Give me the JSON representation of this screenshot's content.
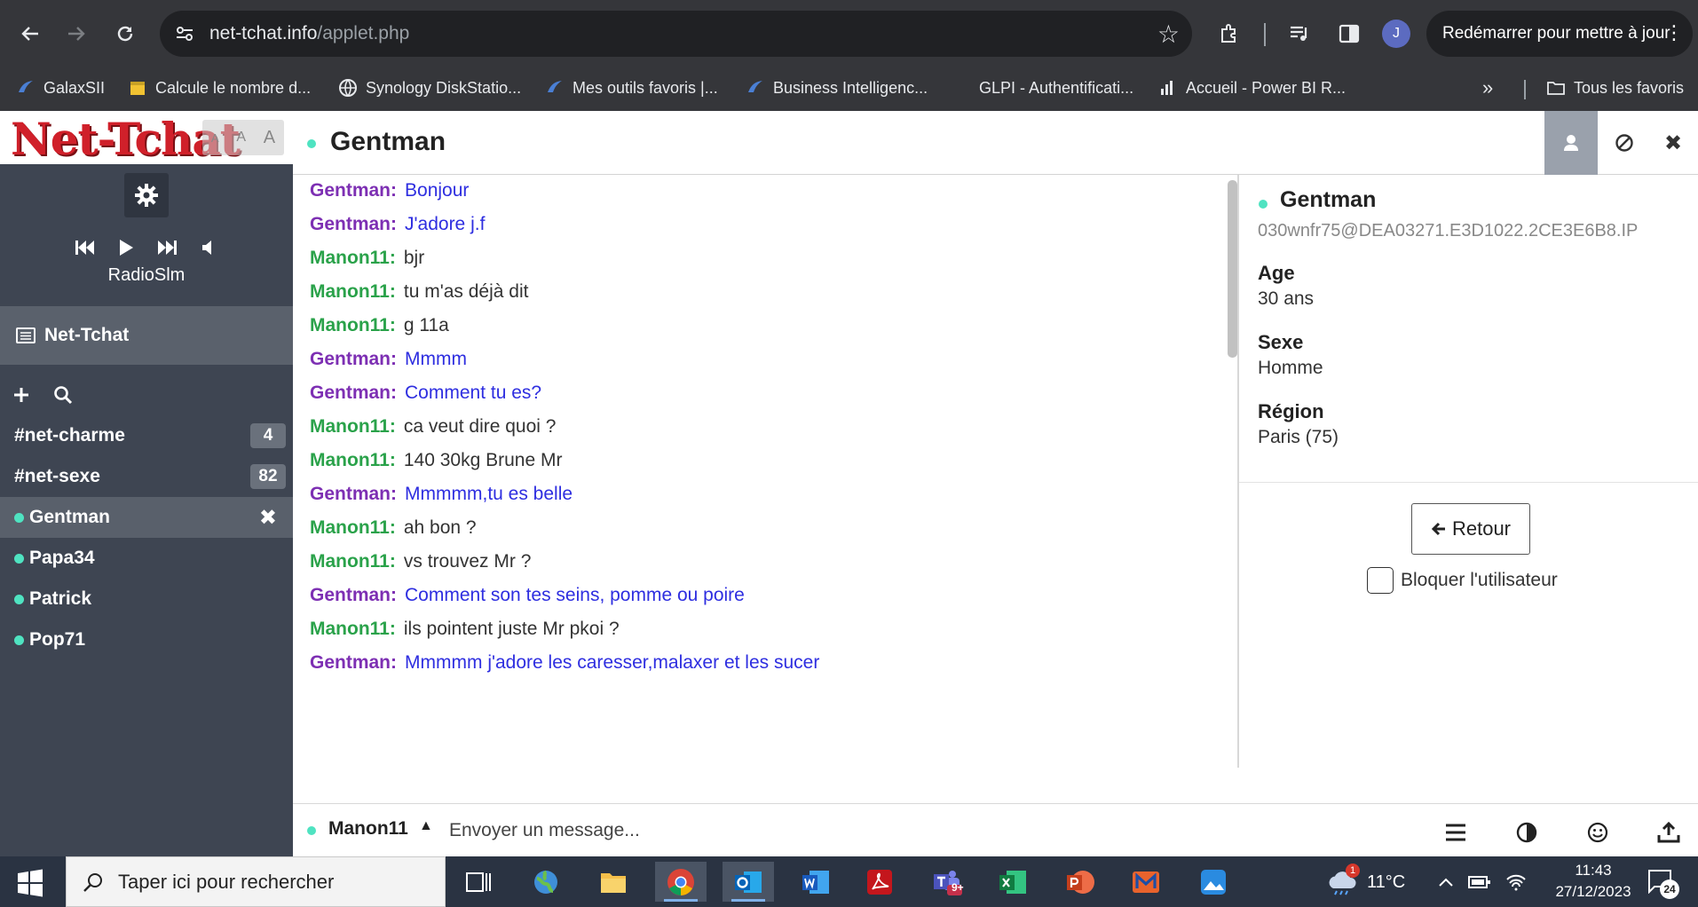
{
  "browser": {
    "url_host": "net-tchat.info",
    "url_path": "/applet.php",
    "profile_initial": "J",
    "update_label": "Redémarrer pour mettre à jour",
    "bookmarks": [
      {
        "label": "GalaxSII",
        "icon": "sii-icon"
      },
      {
        "label": "Calcule le nombre d...",
        "icon": "calendar-icon"
      },
      {
        "label": "Synology DiskStatio...",
        "icon": "globe-icon"
      },
      {
        "label": "Mes outils favoris |...",
        "icon": "sii-icon"
      },
      {
        "label": "Business Intelligenc...",
        "icon": "sii-icon"
      },
      {
        "label": "GLPI - Authentificati...",
        "icon": "glpi-icon"
      },
      {
        "label": "Accueil - Power BI R...",
        "icon": "powerbi-icon"
      }
    ],
    "all_bookmarks_label": "Tous les favoris"
  },
  "sidebar": {
    "logo_text": "Net-Tchat",
    "zoom_buttons": [
      "A",
      "A",
      "A"
    ],
    "radio_name": "RadioSlm",
    "channel_header": "Net-Tchat",
    "rooms": [
      {
        "label": "#net-charme",
        "count": "4"
      },
      {
        "label": "#net-sexe",
        "count": "82"
      }
    ],
    "users": [
      {
        "label": "Gentman",
        "active": true
      },
      {
        "label": "Papa34",
        "active": false
      },
      {
        "label": "Patrick",
        "active": false
      },
      {
        "label": "Pop71",
        "active": false
      }
    ],
    "close_glyph": "✖"
  },
  "chat": {
    "title": "Gentman",
    "messages": [
      {
        "nick": "Gentman:",
        "text": "Bonjour",
        "who": "g"
      },
      {
        "nick": "Gentman:",
        "text": "J'adore j.f",
        "who": "g"
      },
      {
        "nick": "Manon11:",
        "text": "bjr",
        "who": "m"
      },
      {
        "nick": "Manon11:",
        "text": "tu m'as déjà dit",
        "who": "m"
      },
      {
        "nick": "Manon11:",
        "text": "g 11a",
        "who": "m"
      },
      {
        "nick": "Gentman:",
        "text": "Mmmm",
        "who": "g"
      },
      {
        "nick": "Gentman:",
        "text": "Comment tu es?",
        "who": "g"
      },
      {
        "nick": "Manon11:",
        "text": "ca veut dire quoi ?",
        "who": "m"
      },
      {
        "nick": "Manon11:",
        "text": "140 30kg Brune Mr",
        "who": "m"
      },
      {
        "nick": "Gentman:",
        "text": "Mmmmm,tu es belle",
        "who": "g"
      },
      {
        "nick": "Manon11:",
        "text": "ah bon ?",
        "who": "m"
      },
      {
        "nick": "Manon11:",
        "text": "vs trouvez Mr ?",
        "who": "m"
      },
      {
        "nick": "Gentman:",
        "text": "Comment son tes seins, pomme ou poire",
        "who": "g"
      },
      {
        "nick": "Manon11:",
        "text": "ils pointent juste Mr pkoi ?",
        "who": "m"
      },
      {
        "nick": "Gentman:",
        "text": "Mmmmm j'adore les caresser,malaxer et les sucer",
        "who": "g"
      }
    ]
  },
  "profile": {
    "name": "Gentman",
    "host": "030wnfr75@DEA03271.E3D1022.2CE3E6B8.IP",
    "age_label": "Age",
    "age_value": "30 ans",
    "sex_label": "Sexe",
    "sex_value": "Homme",
    "region_label": "Région",
    "region_value": "Paris (75)",
    "back_label": "Retour",
    "block_label": "Bloquer l'utilisateur"
  },
  "input": {
    "current_nick": "Manon11",
    "placeholder": "Envoyer un message..."
  },
  "taskbar": {
    "search_placeholder": "Taper ici pour rechercher",
    "temperature": "11°C",
    "time": "11:43",
    "date": "27/12/2023",
    "notification_count": "24",
    "weather_badge": "1",
    "teams_badge": "9+"
  },
  "colors": {
    "sidebar_bg": "#3e4552",
    "online_dot": "#4fe3c1",
    "gentman_nick": "#7d2fb3",
    "manon_nick": "#2aa24a",
    "gentman_text": "#2e2ee0",
    "logo_red": "#d0202a"
  }
}
